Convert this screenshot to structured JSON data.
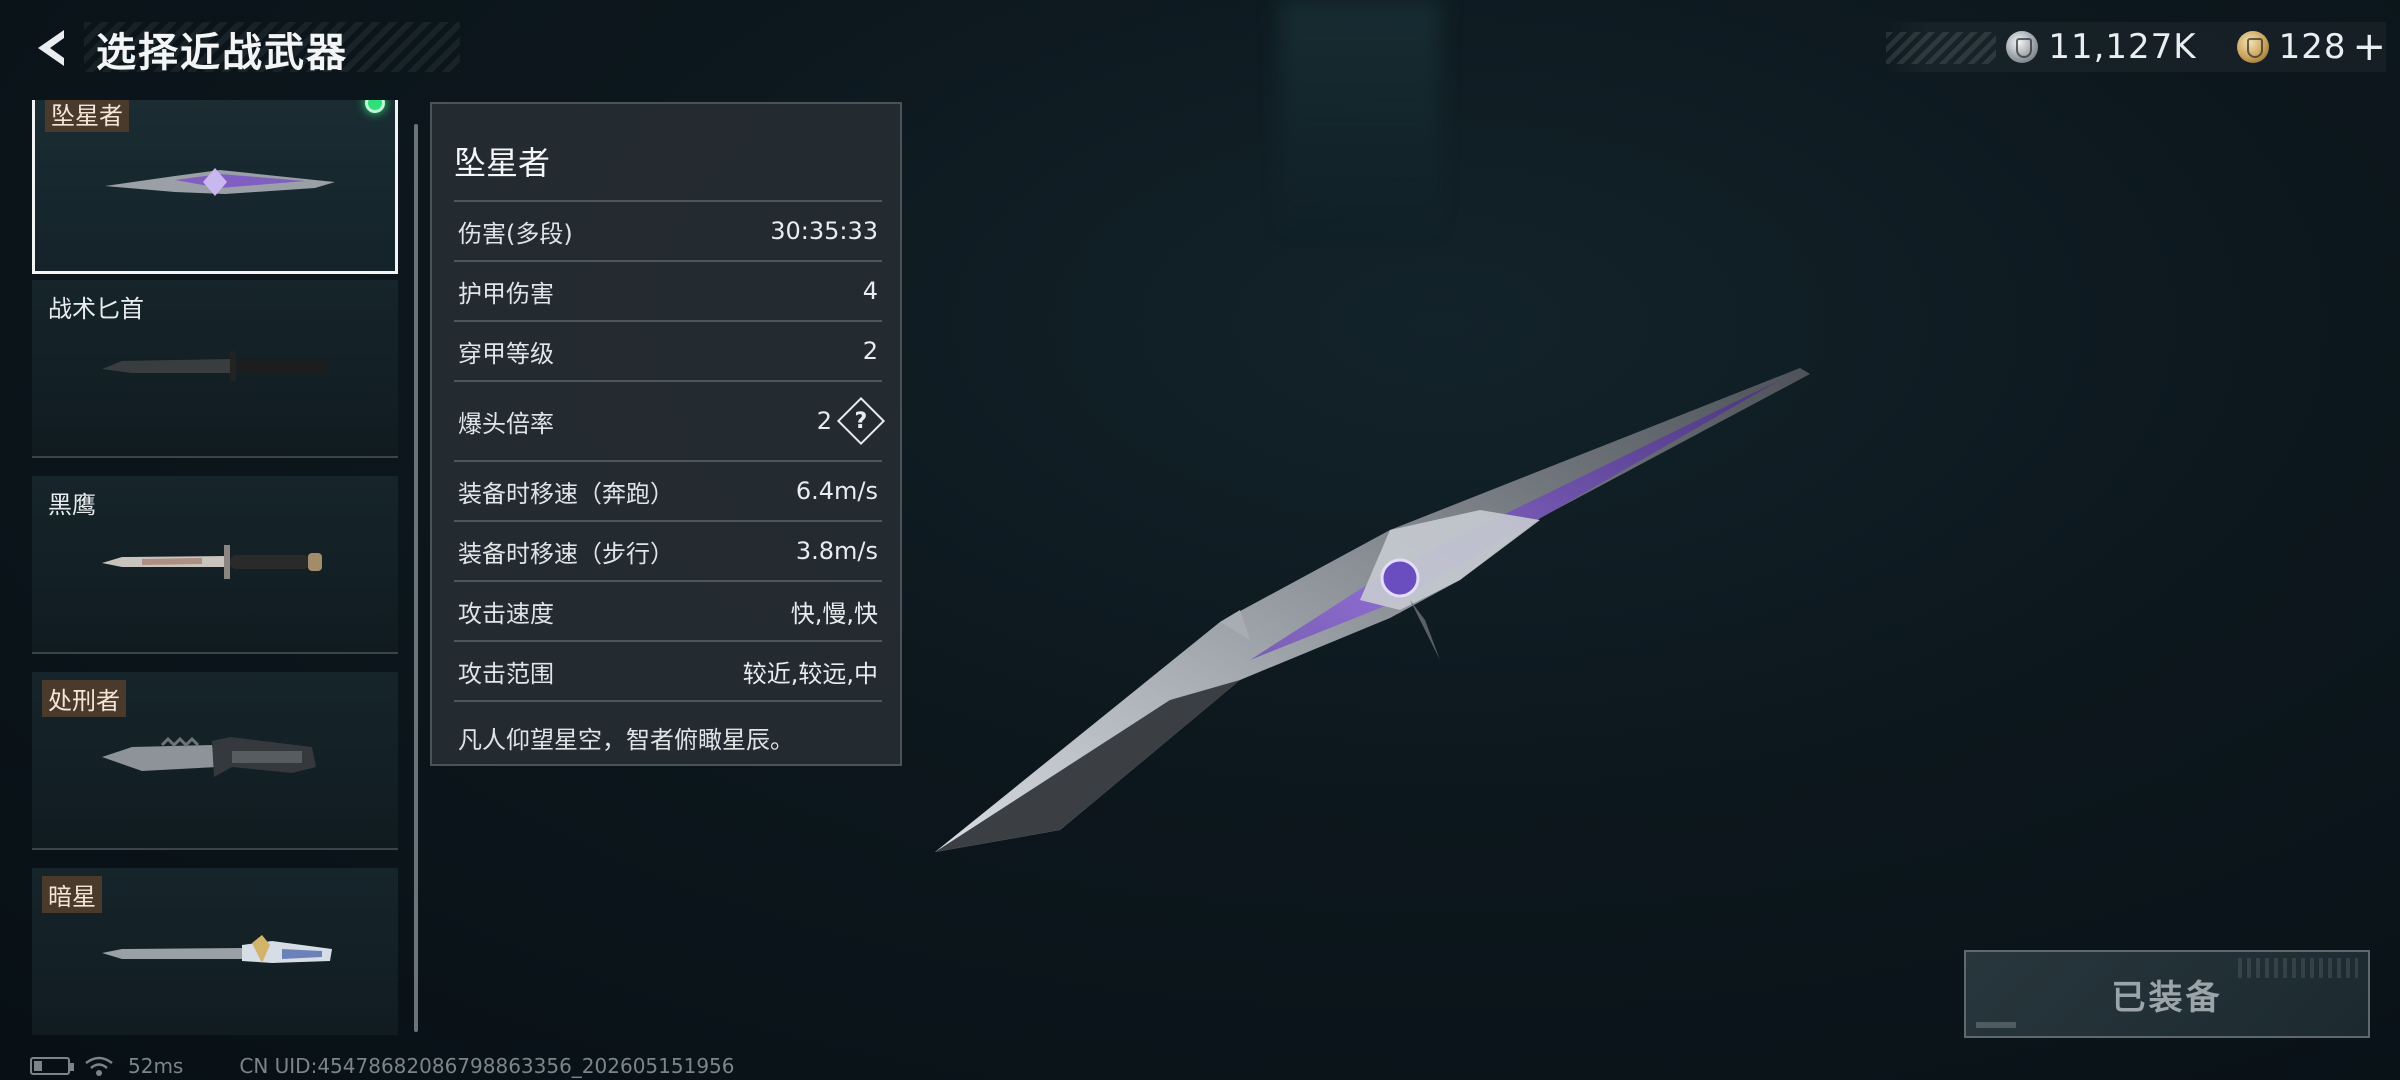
{
  "header": {
    "title": "选择近战武器",
    "silver_amount": "11,127K",
    "gold_amount": "128",
    "add_label": "+"
  },
  "weapons": [
    {
      "name": "坠星者",
      "tag_style": true,
      "equipped": true,
      "selected": true
    },
    {
      "name": "战术匕首",
      "tag_style": false,
      "equipped": false,
      "selected": false
    },
    {
      "name": "黑鹰",
      "tag_style": false,
      "equipped": false,
      "selected": false
    },
    {
      "name": "处刑者",
      "tag_style": true,
      "equipped": false,
      "selected": false
    },
    {
      "name": "暗星",
      "tag_style": true,
      "equipped": false,
      "selected": false
    }
  ],
  "stats": {
    "title": "坠星者",
    "rows": [
      {
        "label": "伤害(多段)",
        "value": "30:35:33"
      },
      {
        "label": "护甲伤害",
        "value": "4"
      },
      {
        "label": "穿甲等级",
        "value": "2"
      },
      {
        "label": "爆头倍率",
        "value": "2",
        "help": "?"
      },
      {
        "label": "装备时移速（奔跑）",
        "value": "6.4m/s"
      },
      {
        "label": "装备时移速（步行）",
        "value": "3.8m/s"
      },
      {
        "label": "攻击速度",
        "value": "快,慢,快"
      },
      {
        "label": "攻击范围",
        "value": "较近,较远,中"
      }
    ],
    "description": "凡人仰望星空，智者俯瞰星辰。"
  },
  "equip_button": {
    "label": "已装备"
  },
  "footer": {
    "ping": "52ms",
    "uid": "CN UID:4547868208679886335​6_202605151956"
  },
  "colors": {
    "accent_green": "#2fe07a",
    "knife_purple": "#7b4fc9"
  }
}
